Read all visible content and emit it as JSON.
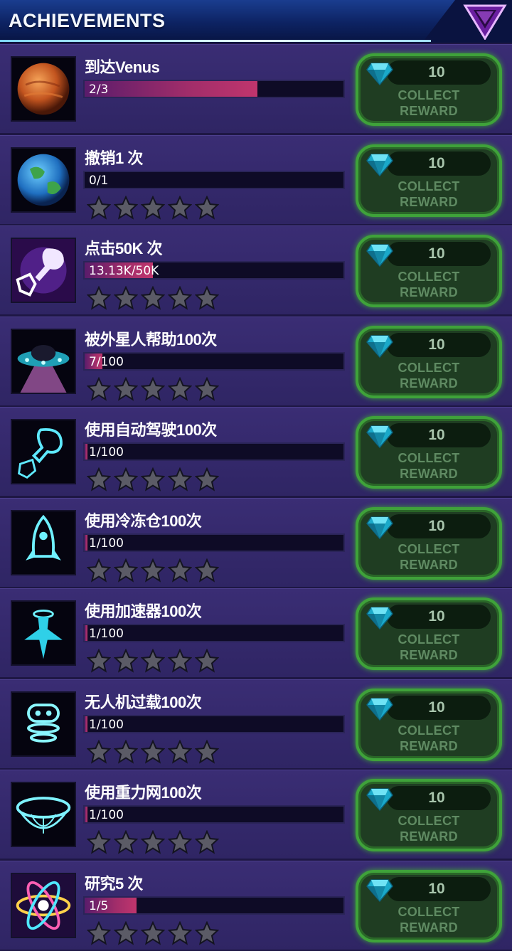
{
  "header": {
    "title": "ACHIEVEMENTS",
    "logo_icon": "chevron-v-logo-icon"
  },
  "colors": {
    "progress_fill": "#a12d6a",
    "reward_border": "#3fa23a",
    "reward_text": "#5f8a62",
    "background": "#2f2564"
  },
  "reward_label": {
    "line1": "COLLECT",
    "line2": "REWARD"
  },
  "achievements": [
    {
      "name": "到达Venus",
      "progress_text": "2/3",
      "progress": 0.667,
      "stars": 0,
      "show_stars": false,
      "reward": "10",
      "icon": "venus-planet-icon"
    },
    {
      "name": "撤销1 次",
      "progress_text": "0/1",
      "progress": 0.0,
      "stars": 0,
      "show_stars": true,
      "reward": "10",
      "icon": "earth-planet-icon"
    },
    {
      "name": "点击50K 次",
      "progress_text": "13.13K/50K",
      "progress": 0.263,
      "stars": 0,
      "show_stars": true,
      "reward": "10",
      "icon": "tap-hand-icon"
    },
    {
      "name": "被外星人帮助100次",
      "progress_text": "7/100",
      "progress": 0.07,
      "stars": 0,
      "show_stars": true,
      "reward": "10",
      "icon": "ufo-icon"
    },
    {
      "name": "使用自动驾驶100次",
      "progress_text": "1/100",
      "progress": 0.01,
      "stars": 0,
      "show_stars": true,
      "reward": "10",
      "icon": "autopilot-icon"
    },
    {
      "name": "使用冷冻仓100次",
      "progress_text": "1/100",
      "progress": 0.01,
      "stars": 0,
      "show_stars": true,
      "reward": "10",
      "icon": "rocket-icon"
    },
    {
      "name": "使用加速器100次",
      "progress_text": "1/100",
      "progress": 0.01,
      "stars": 0,
      "show_stars": true,
      "reward": "10",
      "icon": "booster-icon"
    },
    {
      "name": "无人机过载100次",
      "progress_text": "1/100",
      "progress": 0.01,
      "stars": 0,
      "show_stars": true,
      "reward": "10",
      "icon": "drone-icon"
    },
    {
      "name": "使用重力网100次",
      "progress_text": "1/100",
      "progress": 0.01,
      "stars": 0,
      "show_stars": true,
      "reward": "10",
      "icon": "gravity-net-icon"
    },
    {
      "name": "研究5 次",
      "progress_text": "1/5",
      "progress": 0.2,
      "stars": 0,
      "show_stars": true,
      "reward": "10",
      "icon": "atom-research-icon"
    }
  ]
}
